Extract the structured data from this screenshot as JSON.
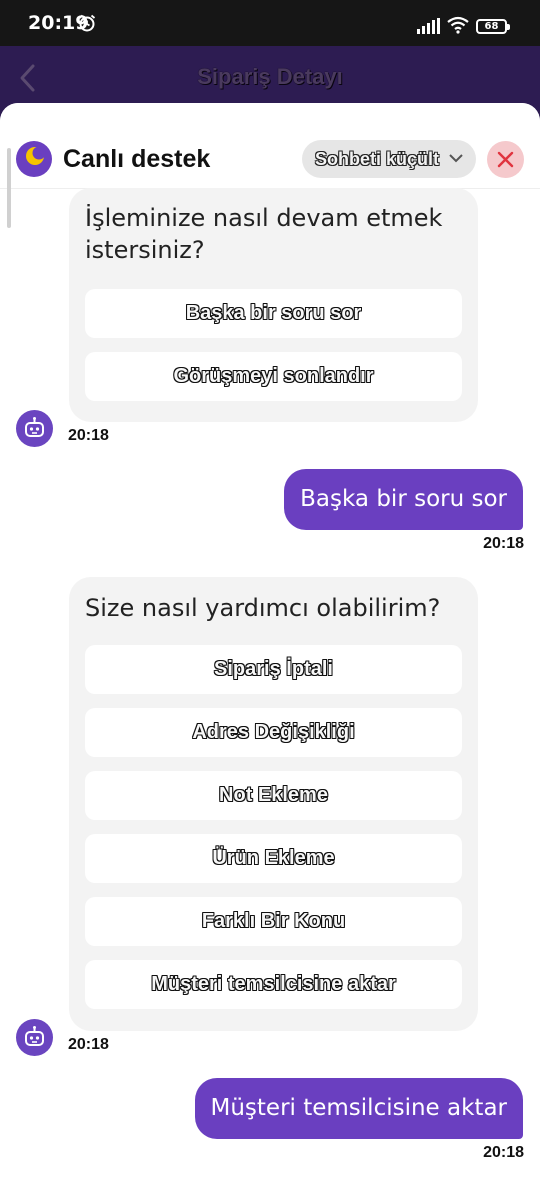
{
  "status_bar": {
    "time": "20:19",
    "battery": "68"
  },
  "header": {
    "title": "Sipariş Detayı"
  },
  "chat": {
    "title": "Canlı destek",
    "minimize_label": "Sohbeti küçült",
    "messages": [
      {
        "type": "bot",
        "text_line1": "İşleminize nasıl devam etmek",
        "text_line2": "istersiniz?",
        "options": [
          "Başka bir soru sor",
          "Görüşmeyi sonlandır"
        ],
        "time": "20:18"
      },
      {
        "type": "user",
        "text": "Başka bir soru sor",
        "time": "20:18"
      },
      {
        "type": "bot",
        "text_line1": "Size nasıl yardımcı olabilirim?",
        "options": [
          "Sipariş İptali",
          "Adres Değişikliği",
          "Not Ekleme",
          "Ürün Ekleme",
          "Farklı Bir Konu",
          "Müşteri temsilcisine aktar"
        ],
        "time": "20:18"
      },
      {
        "type": "user",
        "text": "Müşteri temsilcisine aktar",
        "time": "20:18"
      }
    ]
  },
  "colors": {
    "accent": "#6a3fc0",
    "header_bg": "#2d1c52",
    "bubble_bg": "#f3f3f3",
    "close_bg": "#f5c9cc",
    "close_x": "#e0343f"
  }
}
